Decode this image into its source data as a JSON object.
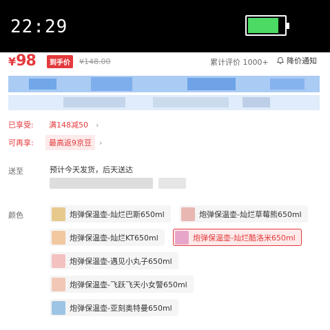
{
  "status_bar": {
    "time": "22:29",
    "battery_color": "#4cd964"
  },
  "price": {
    "currency": "¥",
    "value": "98",
    "badge": "到手价",
    "original": "¥148.00",
    "reviews": "累计评价 1000+",
    "notify": "降价通知"
  },
  "promos": {
    "enjoyed_label": "已享受:",
    "enjoyed_value": "满148减50",
    "extra_label": "可再享:",
    "extra_value": "最高返9京豆"
  },
  "delivery": {
    "label": "送至",
    "text": "预计今天发货，后天送达"
  },
  "color": {
    "label": "颜色",
    "options": [
      {
        "label": "炮弹保温壶-灿烂巴斯650ml",
        "thumb_color": "#e7c98e",
        "selected": false
      },
      {
        "label": "炮弹保温壶-灿烂草莓熊650ml",
        "thumb_color": "#e9b7b1",
        "selected": false
      },
      {
        "label": "炮弹保温壶-灿烂KT650ml",
        "thumb_color": "#f2c8a0",
        "selected": false
      },
      {
        "label": "炮弹保温壶-灿烂酷洛米650ml",
        "thumb_color": "#e7a6c9",
        "selected": true
      },
      {
        "label": "炮弹保温壶-遇见小丸子650ml",
        "thumb_color": "#f4c1c1",
        "selected": false
      },
      {
        "label": "炮弹保温壶-飞跃飞天小女警650ml",
        "thumb_color": "#f1c8b5",
        "selected": false
      },
      {
        "label": "炮弹保温壶-亚刻奥特曼650ml",
        "thumb_color": "#9cc4e4",
        "selected": false
      }
    ]
  },
  "colors": {
    "accent": "#e4393c",
    "selected_bg": "#fdeaea"
  }
}
